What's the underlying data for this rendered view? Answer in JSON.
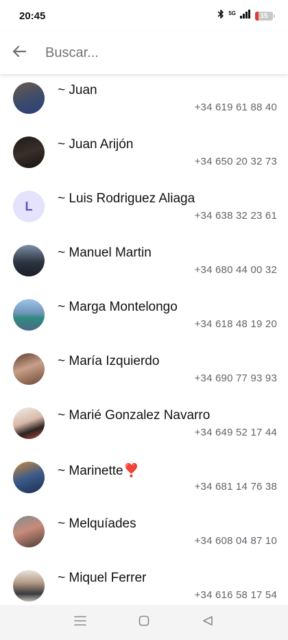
{
  "status_bar": {
    "time": "20:45",
    "network": "5G",
    "battery": "15",
    "battery_color": "#e53935"
  },
  "search": {
    "placeholder": "Buscar...",
    "value": "",
    "back_icon": "arrow-left-icon"
  },
  "contacts": [
    {
      "name": "~ Juan",
      "phone": "+34 619 61 88 40",
      "avatar": "photo"
    },
    {
      "name": "~ Juan Arijón",
      "phone": "+34 650 20 32 73",
      "avatar": "photo"
    },
    {
      "name": "~ Luis Rodriguez Aliaga",
      "phone": "+34 638 32 23 61",
      "avatar": "L"
    },
    {
      "name": "~ Manuel Martin",
      "phone": "+34 680 44 00 32",
      "avatar": "photo"
    },
    {
      "name": "~ Marga Montelongo",
      "phone": "+34 618 48 19 20",
      "avatar": "photo"
    },
    {
      "name": "~ María Izquierdo",
      "phone": "+34 690 77 93 93",
      "avatar": "photo"
    },
    {
      "name": "~ Marié Gonzalez Navarro",
      "phone": "+34 649 52 17 44",
      "avatar": "photo"
    },
    {
      "name": "~ Marinette❣️",
      "phone": "+34 681 14 76 38",
      "avatar": "photo"
    },
    {
      "name": "~ Melquíades",
      "phone": "+34 608 04 87 10",
      "avatar": "photo"
    },
    {
      "name": "~ Miquel Ferrer",
      "phone": "+34 616 58 17 54",
      "avatar": "photo"
    }
  ],
  "nav_bar": {
    "menu_icon": "menu-icon",
    "home_icon": "home-square-icon",
    "back_icon": "back-triangle-icon"
  }
}
